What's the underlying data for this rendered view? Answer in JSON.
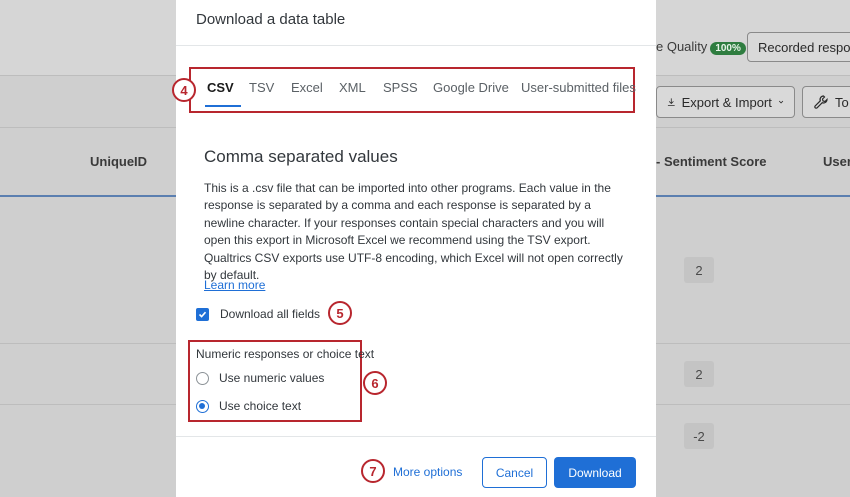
{
  "background": {
    "quality_label": "e Quality",
    "quality_badge": "100%",
    "recorded_button": "Recorded respon",
    "export_import_button": "Export & Import",
    "tools_button": "To",
    "col_unique_id": "UniqueID",
    "col_sentiment": "- Sentiment Score",
    "col_user": "User",
    "cell_values": [
      "2",
      "2",
      "-2"
    ]
  },
  "modal": {
    "title": "Download a data table",
    "tabs": [
      "CSV",
      "TSV",
      "Excel",
      "XML",
      "SPSS",
      "Google Drive",
      "User-submitted files"
    ],
    "active_tab": "CSV",
    "section_title": "Comma separated values",
    "description": "This is a .csv file that can be imported into other programs. Each value in the response is separated by a comma and each response is separated by a newline character. If your responses contain special characters and you will open this export in Microsoft Excel we recommend using the TSV export. Qualtrics CSV exports use UTF-8 encoding, which Excel will not open correctly by default.",
    "learn_more": "Learn more",
    "download_all_fields": "Download all fields",
    "download_all_fields_checked": true,
    "choice_heading": "Numeric responses or choice text",
    "options": [
      "Use numeric values",
      "Use choice text"
    ],
    "selected_option": "Use choice text",
    "more_options": "More options",
    "cancel": "Cancel",
    "download": "Download"
  },
  "callouts": [
    "4",
    "5",
    "6",
    "7"
  ],
  "colors": {
    "accent": "#1f6fd6",
    "callout": "#b8262e",
    "badge": "#2f7d40"
  }
}
